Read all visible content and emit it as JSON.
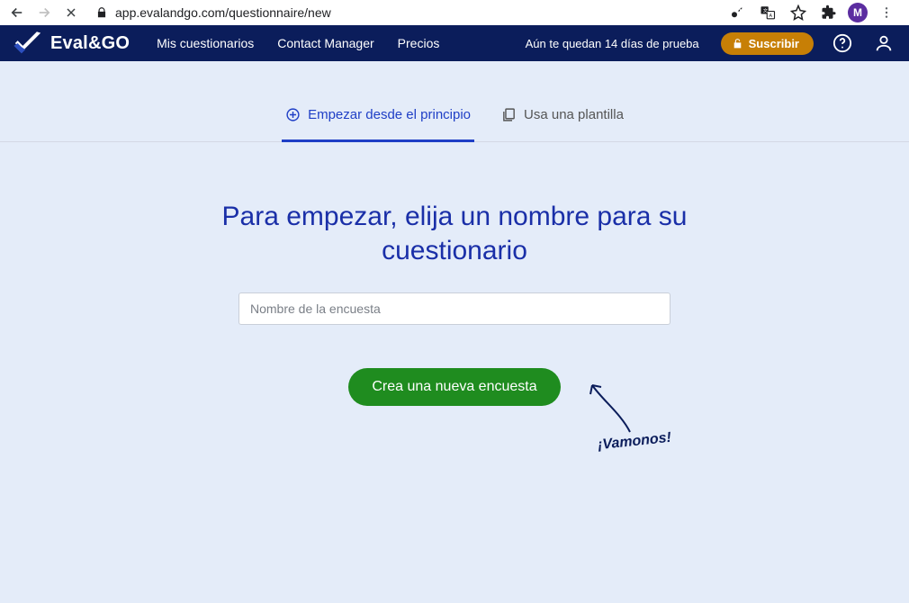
{
  "browser": {
    "url": "app.evalandgo.com/questionnaire/new",
    "avatar_initial": "M"
  },
  "header": {
    "brand": "Eval&GO",
    "nav": {
      "my_surveys": "Mis cuestionarios",
      "contact_manager": "Contact Manager",
      "pricing": "Precios"
    },
    "trial_text": "Aún te quedan 14 días de prueba",
    "subscribe_label": "Suscribir"
  },
  "tabs": {
    "start_from_scratch": "Empezar desde el principio",
    "use_template": "Usa una plantilla"
  },
  "main": {
    "heading": "Para empezar, elija un nombre para su cuestionario",
    "input_placeholder": "Nombre de la encuesta",
    "create_button": "Crea una nueva encuesta",
    "annotation": "¡Vamonos!"
  }
}
